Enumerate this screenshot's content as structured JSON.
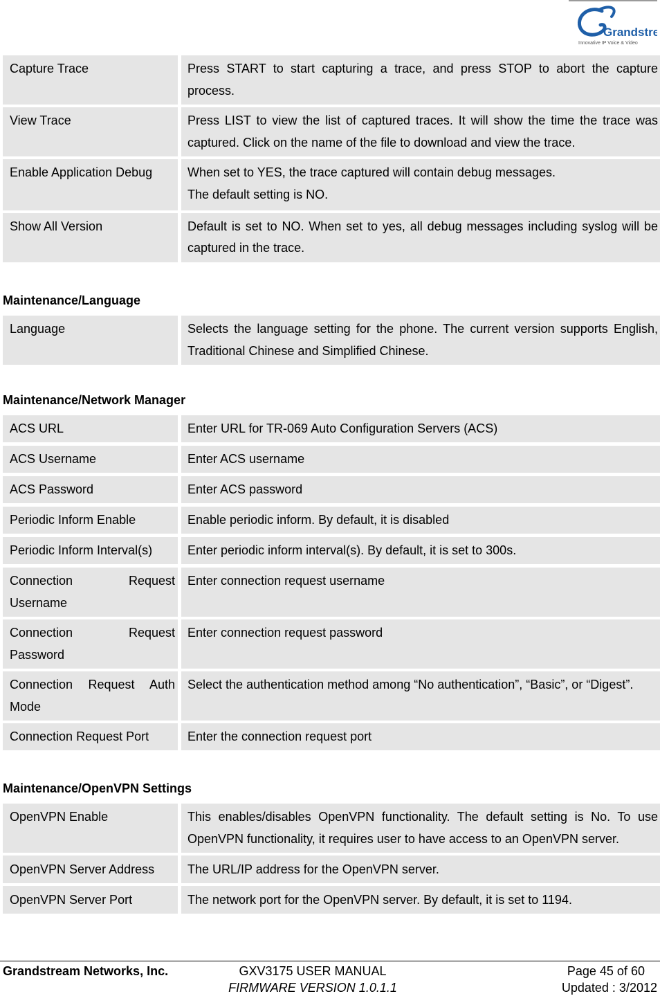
{
  "logo": {
    "brand": "Grandstream",
    "tagline": "Innovative IP Voice & Video"
  },
  "sections": [
    {
      "title": "",
      "rows": [
        {
          "name": "Capture Trace",
          "desc": "Press START to start capturing a trace, and press STOP to abort the capture process."
        },
        {
          "name": "View Trace",
          "desc": "Press LIST to view the list of captured traces. It will show the time the trace was captured. Click on the name of the file to download and view the trace."
        },
        {
          "name": "Enable Application Debug",
          "desc": "When set to YES, the trace captured will contain debug messages.",
          "desc2": "The default setting is NO."
        },
        {
          "name": "Show All Version",
          "desc": "Default is set to NO.  When set to yes, all debug messages including syslog will be captured in the trace."
        }
      ]
    },
    {
      "title": "Maintenance/Language",
      "rows": [
        {
          "name": "Language",
          "desc": "Selects the language setting for the phone. The current version supports English, Traditional Chinese and Simplified Chinese."
        }
      ]
    },
    {
      "title": "Maintenance/Network Manager",
      "rows": [
        {
          "name": "ACS URL",
          "desc": "Enter URL for TR-069 Auto Configuration Servers (ACS)"
        },
        {
          "name": "ACS Username",
          "desc": "Enter ACS username"
        },
        {
          "name": "ACS Password",
          "desc": "Enter ACS password"
        },
        {
          "name": "Periodic Inform Enable",
          "desc": "Enable periodic inform. By default, it is disabled"
        },
        {
          "name": "Periodic Inform Interval(s)",
          "desc": "Enter periodic inform interval(s). By default, it is set to 300s."
        },
        {
          "name": "Connection Request Username",
          "desc": "Enter connection request username"
        },
        {
          "name": "Connection Request Password",
          "desc": "Enter connection request password"
        },
        {
          "name": "Connection Request Auth Mode",
          "desc": "Select the authentication method among “No authentication”, “Basic”, or “Digest”."
        },
        {
          "name": "Connection Request Port",
          "desc": "Enter the connection request port"
        }
      ]
    },
    {
      "title": "Maintenance/OpenVPN Settings",
      "rows": [
        {
          "name": "OpenVPN Enable",
          "desc": "This enables/disables OpenVPN functionality. The default setting is No. To use OpenVPN functionality, it requires user to have access to an OpenVPN server."
        },
        {
          "name": "OpenVPN Server Address",
          "desc": "The URL/IP address for the OpenVPN server."
        },
        {
          "name": "OpenVPN Server Port",
          "desc": "The network port for the OpenVPN server. By default, it is set to 1194."
        }
      ]
    }
  ],
  "footer": {
    "company": "Grandstream Networks, Inc.",
    "manual": "GXV3175 USER MANUAL",
    "firmware": "FIRMWARE VERSION 1.0.1.1",
    "page": "Page 45 of 60",
    "updated": "Updated : 3/2012"
  },
  "colors": {
    "cell_bg": "#e5e5e5",
    "logo_blue": "#1f5fa8"
  }
}
